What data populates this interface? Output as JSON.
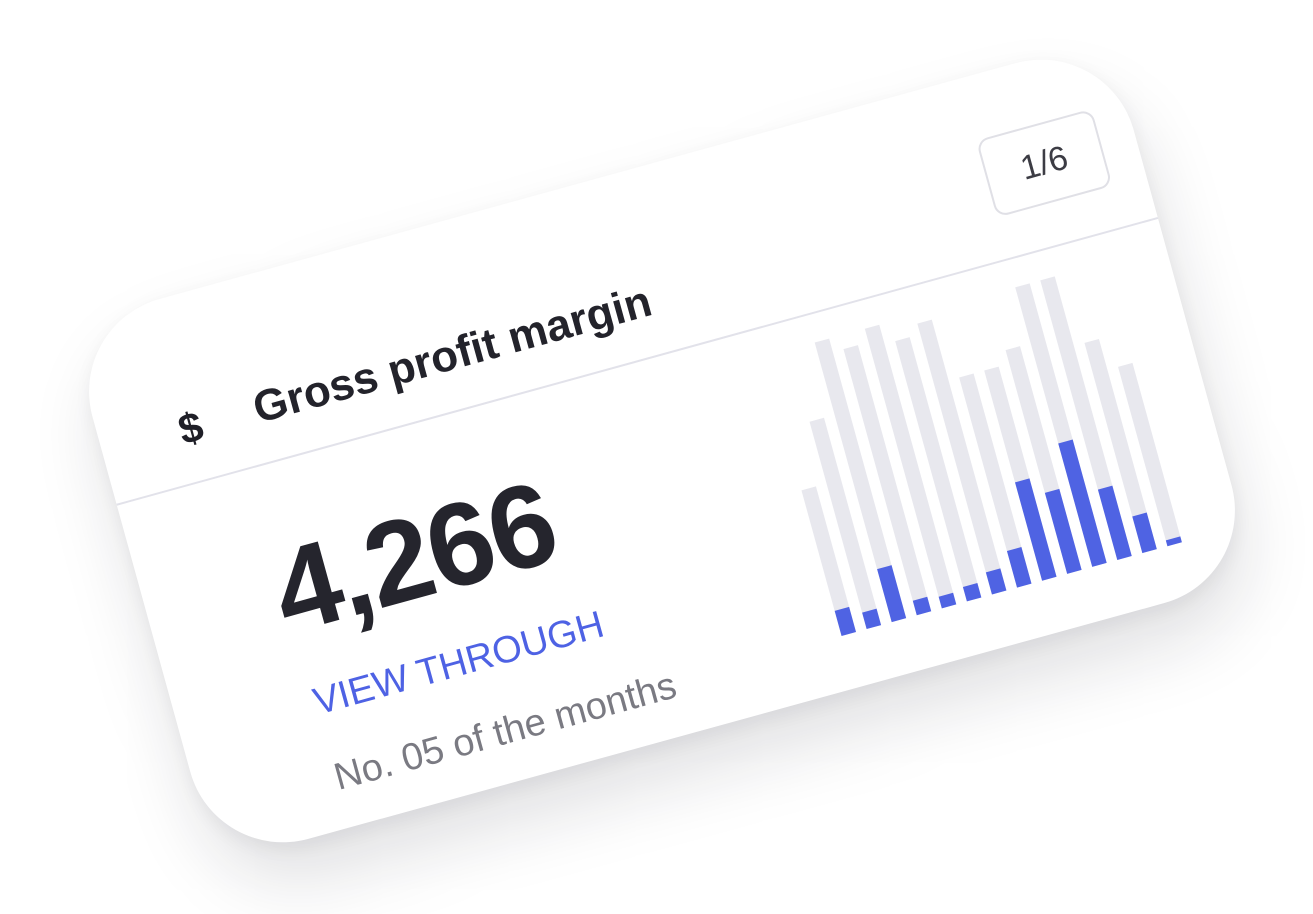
{
  "card": {
    "icon": "dollar-icon",
    "icon_glyph": "$",
    "title": "Gross profit margin",
    "pager": "1/6",
    "value": "4,266",
    "link_label": "VIEW THROUGH",
    "subtext": "No. 05 of the months"
  },
  "colors": {
    "accent": "#4f63e3",
    "track": "#e8e8ee",
    "title": "#23232b",
    "muted": "#7a7a82"
  },
  "chart_data": {
    "type": "bar",
    "bars": [
      {
        "total": 0.52,
        "filled": 0.09
      },
      {
        "total": 0.74,
        "filled": 0.06
      },
      {
        "total": 1.0,
        "filled": 0.19
      },
      {
        "total": 0.95,
        "filled": 0.05
      },
      {
        "total": 1.0,
        "filled": 0.04
      },
      {
        "total": 0.93,
        "filled": 0.05
      },
      {
        "total": 0.97,
        "filled": 0.08
      },
      {
        "total": 0.75,
        "filled": 0.13
      },
      {
        "total": 0.75,
        "filled": 0.35
      },
      {
        "total": 0.8,
        "filled": 0.29
      },
      {
        "total": 1.0,
        "filled": 0.44
      },
      {
        "total": 1.0,
        "filled": 0.25
      },
      {
        "total": 0.75,
        "filled": 0.13
      },
      {
        "total": 0.64,
        "filled": 0.02
      }
    ]
  }
}
